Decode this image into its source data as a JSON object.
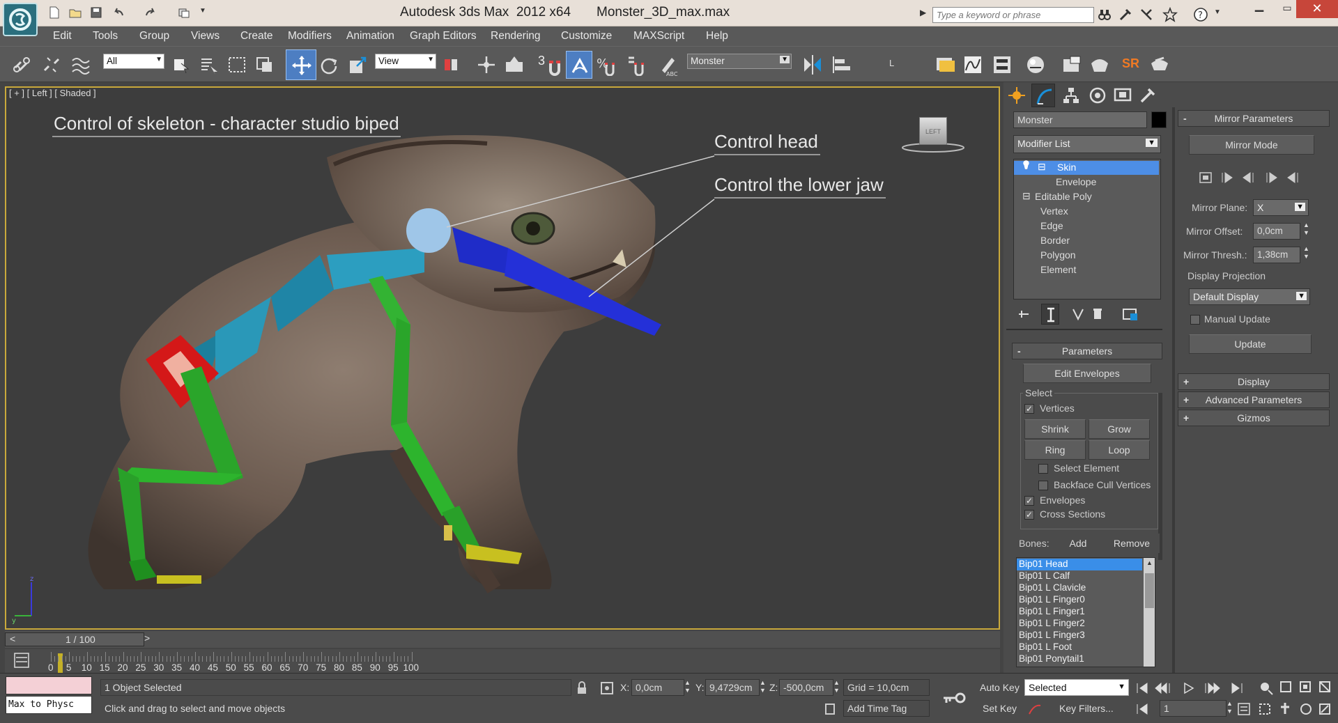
{
  "titlebar": {
    "title": "Autodesk 3ds Max  2012 x64       Monster_3D_max.max",
    "search_placeholder": "Type a keyword or phrase"
  },
  "menu": [
    "Edit",
    "Tools",
    "Group",
    "Views",
    "Create",
    "Modifiers",
    "Animation",
    "Graph Editors",
    "Rendering",
    "Customize",
    "MAXScript",
    "Help"
  ],
  "toolbar": {
    "selection_filter": "All",
    "reference_coord": "View",
    "named_selection": "Monster",
    "snap_number": "3",
    "sr_label": "SR",
    "small_label": "L"
  },
  "viewport": {
    "label": "[ + ] [ Left ] [ Shaded ]",
    "viewcube_label": "LEFT",
    "annotations": {
      "title": "Control of skeleton - character studio biped",
      "head": "Control head",
      "jaw": "Control the lower jaw"
    },
    "axis_z": "z",
    "axis_y": "y"
  },
  "command_panel": {
    "object_name": "Monster",
    "modifier_list": "Modifier List",
    "stack": [
      {
        "label": "Skin",
        "level": 0,
        "selected": true
      },
      {
        "label": "Envelope",
        "level": 2,
        "selected": false
      },
      {
        "label": "Editable Poly",
        "level": 0,
        "selected": false
      },
      {
        "label": "Vertex",
        "level": 1,
        "selected": false
      },
      {
        "label": "Edge",
        "level": 1,
        "selected": false
      },
      {
        "label": "Border",
        "level": 1,
        "selected": false
      },
      {
        "label": "Polygon",
        "level": 1,
        "selected": false
      },
      {
        "label": "Element",
        "level": 1,
        "selected": false
      }
    ],
    "parameters": {
      "header": "Parameters",
      "edit_envelopes": "Edit Envelopes",
      "select_label": "Select",
      "vertices": "Vertices",
      "shrink": "Shrink",
      "grow": "Grow",
      "ring": "Ring",
      "loop": "Loop",
      "select_element": "Select Element",
      "backface": "Backface Cull Vertices",
      "envelopes": "Envelopes",
      "cross_sections": "Cross Sections",
      "bones_label": "Bones:",
      "add": "Add",
      "remove": "Remove",
      "bones": [
        "Bip01 Head",
        "Bip01 L Calf",
        "Bip01 L Clavicle",
        "Bip01 L Finger0",
        "Bip01 L Finger1",
        "Bip01 L Finger2",
        "Bip01 L Finger3",
        "Bip01 L Foot",
        "Bip01 Ponytail1"
      ]
    },
    "mirror": {
      "header": "Mirror Parameters",
      "mirror_mode": "Mirror Mode",
      "plane_label": "Mirror Plane:",
      "plane_value": "X",
      "offset_label": "Mirror Offset:",
      "offset_value": "0,0cm",
      "thresh_label": "Mirror Thresh.:",
      "thresh_value": "1,38cm",
      "projection_label": "Display Projection",
      "projection_value": "Default Display",
      "manual_update": "Manual Update",
      "update": "Update"
    },
    "rollouts": [
      "Display",
      "Advanced Parameters",
      "Gizmos"
    ]
  },
  "timeline": {
    "frame": "1 / 100",
    "ticks": [
      "0",
      "5",
      "10",
      "15",
      "20",
      "25",
      "30",
      "35",
      "40",
      "45",
      "50",
      "55",
      "60",
      "65",
      "70",
      "75",
      "80",
      "85",
      "90",
      "95",
      "100"
    ]
  },
  "status": {
    "maxscript": "Max to Physc",
    "selected": "1 Object Selected",
    "prompt": "Click and drag to select and move objects",
    "x_label": "X:",
    "x_value": "0,0cm",
    "y_label": "Y:",
    "y_value": "9,4729cm",
    "z_label": "Z:",
    "z_value": "-500,0cm",
    "grid": "Grid = 10,0cm",
    "add_time_tag": "Add Time Tag",
    "auto_key": "Auto Key",
    "key_mode": "Selected",
    "set_key": "Set Key",
    "key_filters": "Key Filters...",
    "current_frame": "1"
  }
}
